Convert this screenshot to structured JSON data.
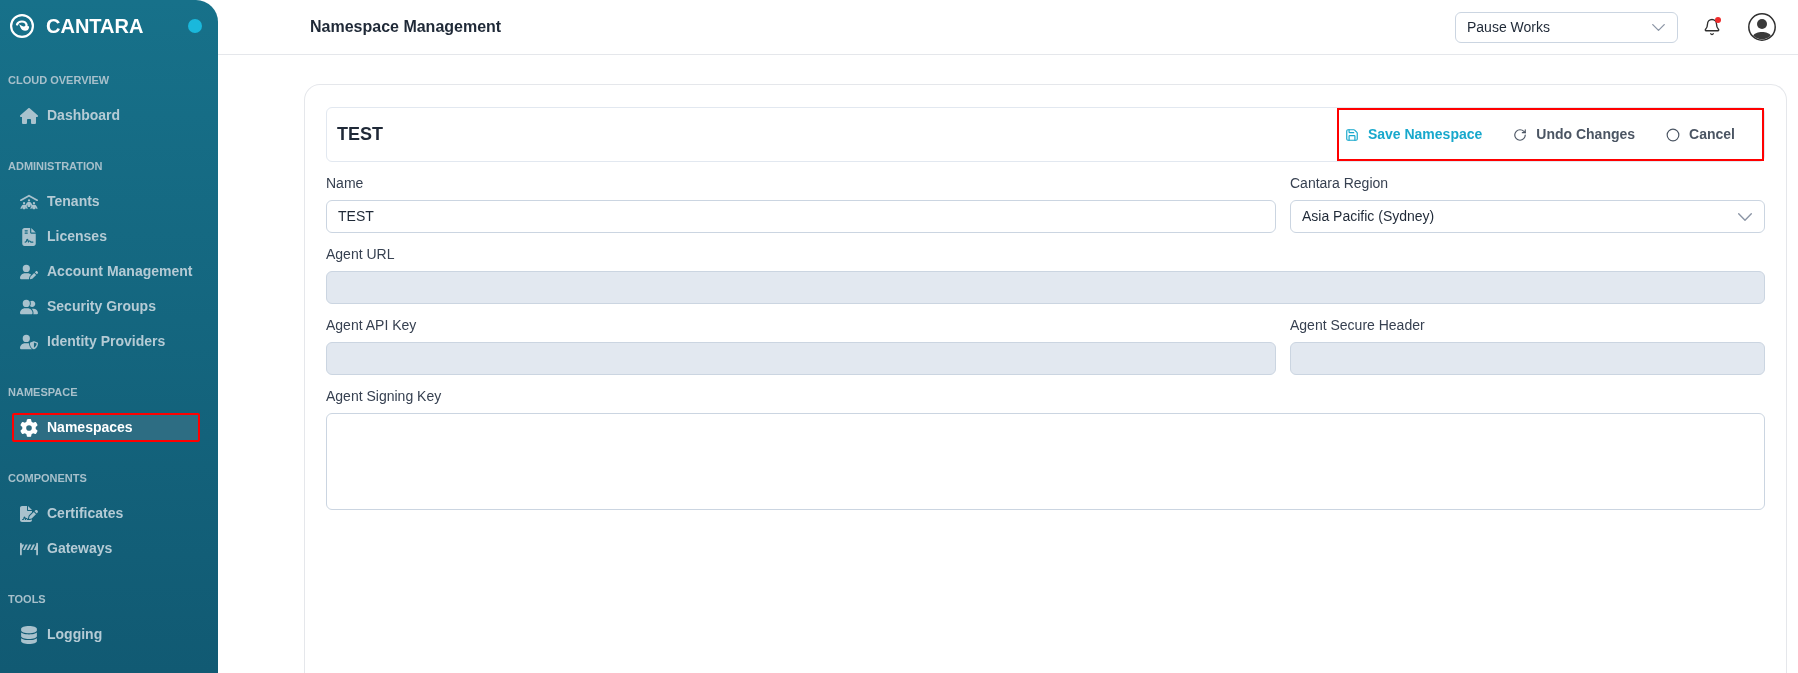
{
  "sidebar": {
    "brand": "CANTARA",
    "sections": [
      {
        "title": "CLOUD OVERVIEW",
        "items": [
          {
            "label": "Dashboard",
            "selected": false,
            "outlined": false
          }
        ]
      },
      {
        "title": "ADMINISTRATION",
        "items": [
          {
            "label": "Tenants",
            "selected": false,
            "outlined": false
          },
          {
            "label": "Licenses",
            "selected": false,
            "outlined": false
          },
          {
            "label": "Account Management",
            "selected": false,
            "outlined": false
          },
          {
            "label": "Security Groups",
            "selected": false,
            "outlined": false
          },
          {
            "label": "Identity Providers",
            "selected": false,
            "outlined": false
          }
        ]
      },
      {
        "title": "NAMESPACE",
        "items": [
          {
            "label": "Namespaces",
            "selected": true,
            "outlined": true
          }
        ]
      },
      {
        "title": "COMPONENTS",
        "items": [
          {
            "label": "Certificates",
            "selected": false,
            "outlined": false
          },
          {
            "label": "Gateways",
            "selected": false,
            "outlined": false
          }
        ]
      },
      {
        "title": "TOOLS",
        "items": [
          {
            "label": "Logging",
            "selected": false,
            "outlined": false
          }
        ]
      }
    ]
  },
  "topbar": {
    "title": "Namespace Management",
    "workspace_select": {
      "value": "Pause Works"
    },
    "notifications": {
      "unread": true
    }
  },
  "namespace_form": {
    "title": "TEST",
    "actions_outlined": true,
    "actions": [
      {
        "label": "Save Namespace",
        "kind": "primary"
      },
      {
        "label": "Undo Changes",
        "kind": "secondary"
      },
      {
        "label": "Cancel",
        "kind": "secondary"
      }
    ],
    "rows": [
      {
        "fields": [
          {
            "label": "Name",
            "kind": "text",
            "value": "TEST",
            "disabled": false
          },
          {
            "label": "Cantara Region",
            "kind": "select",
            "value": "Asia Pacific (Sydney)",
            "disabled": false
          }
        ]
      },
      {
        "fields": [
          {
            "label": "Agent URL",
            "kind": "text",
            "disabled": true
          }
        ]
      },
      {
        "fields": [
          {
            "label": "Agent API Key",
            "kind": "text",
            "disabled": true
          },
          {
            "label": "Agent Secure Header",
            "kind": "text",
            "disabled": true
          }
        ]
      },
      {
        "fields": [
          {
            "label": "Agent Signing Key",
            "kind": "textarea",
            "disabled": false
          }
        ]
      }
    ]
  }
}
